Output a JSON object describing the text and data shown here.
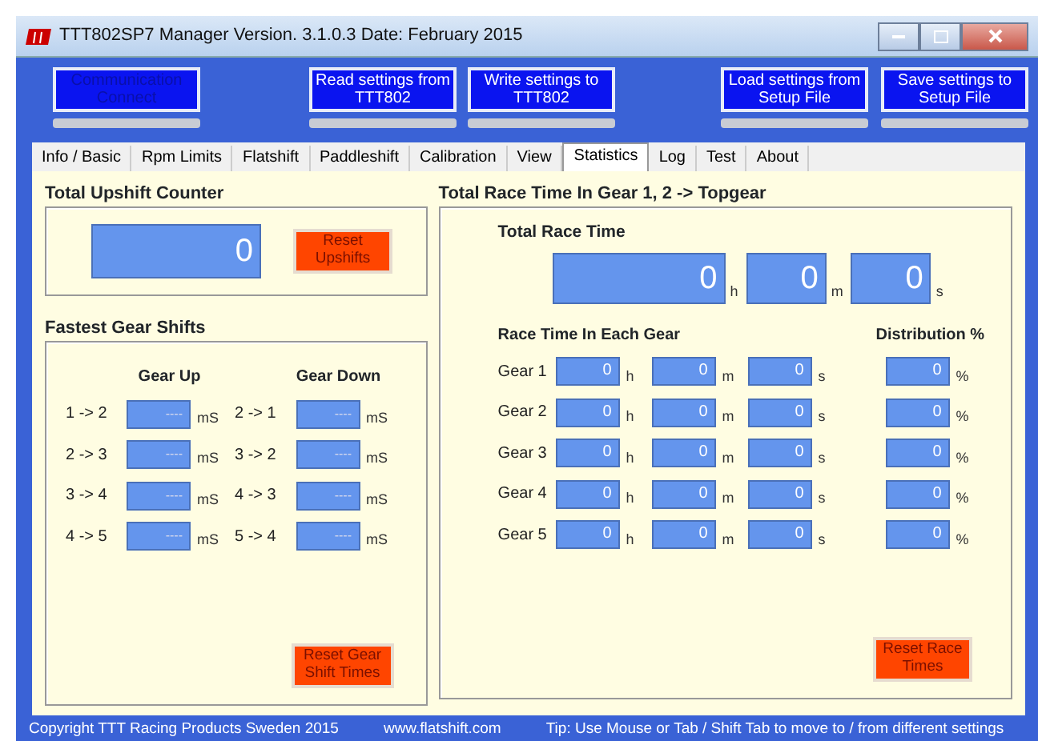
{
  "window": {
    "title": "TTT802SP7 Manager Version. 3.1.0.3  Date: February 2015"
  },
  "toolbar_buttons": [
    {
      "label": "Communication Connect",
      "disabled": true,
      "level": 0
    },
    {
      "label": "Read settings from TTT802",
      "disabled": false,
      "level": 0
    },
    {
      "label": "Write settings to TTT802",
      "disabled": false,
      "level": 0
    },
    {
      "label": "Load settings from Setup File",
      "disabled": false,
      "level": 0
    },
    {
      "label": "Save settings to Setup File",
      "disabled": false,
      "level": 0
    }
  ],
  "tabs": [
    {
      "label": "Info / Basic",
      "selected": false
    },
    {
      "label": "Rpm Limits",
      "selected": false
    },
    {
      "label": "Flatshift",
      "selected": false
    },
    {
      "label": "Paddleshift",
      "selected": false
    },
    {
      "label": "Calibration",
      "selected": false
    },
    {
      "label": "View",
      "selected": false
    },
    {
      "label": "Statistics",
      "selected": true
    },
    {
      "label": "Log",
      "selected": false
    },
    {
      "label": "Test",
      "selected": false
    },
    {
      "label": "About",
      "selected": false
    }
  ],
  "upshift": {
    "title": "Total Upshift Counter",
    "value": "0",
    "reset_button": "Reset Upshifts"
  },
  "gear_shifts": {
    "title": "Fastest Gear Shifts",
    "up_heading": "Gear Up",
    "down_heading": "Gear Down",
    "up": [
      {
        "label": "1 -> 2",
        "value": "----",
        "unit": "mS"
      },
      {
        "label": "2 -> 3",
        "value": "----",
        "unit": "mS"
      },
      {
        "label": "3 -> 4",
        "value": "----",
        "unit": "mS"
      },
      {
        "label": "4 -> 5",
        "value": "----",
        "unit": "mS"
      }
    ],
    "down": [
      {
        "label": "2 -> 1",
        "value": "----",
        "unit": "mS"
      },
      {
        "label": "3 -> 2",
        "value": "----",
        "unit": "mS"
      },
      {
        "label": "4 -> 3",
        "value": "----",
        "unit": "mS"
      },
      {
        "label": "5 -> 4",
        "value": "----",
        "unit": "mS"
      }
    ],
    "reset_button": "Reset Gear Shift Times"
  },
  "race_time": {
    "title": "Total Race Time In Gear 1, 2 -> Topgear",
    "total_heading": "Total Race Time",
    "total": [
      {
        "value": "0",
        "unit": "h"
      },
      {
        "value": "0",
        "unit": "m"
      },
      {
        "value": "0",
        "unit": "s"
      }
    ],
    "each_heading": "Race Time In Each Gear",
    "distribution_heading": "Distribution %",
    "gears": [
      {
        "label": "Gear 1",
        "times": [
          {
            "value": "0",
            "unit": "h"
          },
          {
            "value": "0",
            "unit": "m"
          },
          {
            "value": "0",
            "unit": "s"
          }
        ],
        "distribution": {
          "value": "0",
          "unit": "%"
        }
      },
      {
        "label": "Gear 2",
        "times": [
          {
            "value": "0",
            "unit": "h"
          },
          {
            "value": "0",
            "unit": "m"
          },
          {
            "value": "0",
            "unit": "s"
          }
        ],
        "distribution": {
          "value": "0",
          "unit": "%"
        }
      },
      {
        "label": "Gear 3",
        "times": [
          {
            "value": "0",
            "unit": "h"
          },
          {
            "value": "0",
            "unit": "m"
          },
          {
            "value": "0",
            "unit": "s"
          }
        ],
        "distribution": {
          "value": "0",
          "unit": "%"
        }
      },
      {
        "label": "Gear 4",
        "times": [
          {
            "value": "0",
            "unit": "h"
          },
          {
            "value": "0",
            "unit": "m"
          },
          {
            "value": "0",
            "unit": "s"
          }
        ],
        "distribution": {
          "value": "0",
          "unit": "%"
        }
      },
      {
        "label": "Gear 5",
        "times": [
          {
            "value": "0",
            "unit": "h"
          },
          {
            "value": "0",
            "unit": "m"
          },
          {
            "value": "0",
            "unit": "s"
          }
        ],
        "distribution": {
          "value": "0",
          "unit": "%"
        }
      }
    ],
    "reset_button": "Reset Race Times"
  },
  "status_bar": [
    "Copyright TTT Racing Products Sweden  2015",
    "www.flatshift.com",
    "Tip:  Use Mouse or Tab / Shift Tab to move to / from  different settings"
  ]
}
